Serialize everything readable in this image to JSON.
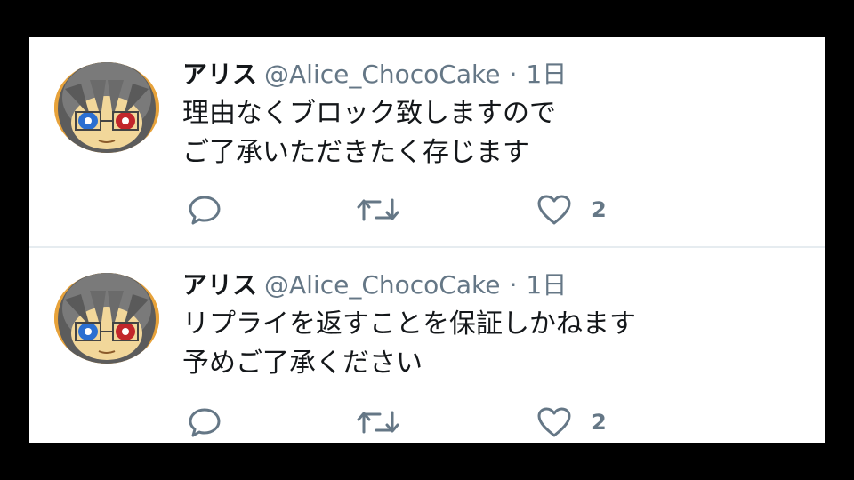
{
  "tweets": [
    {
      "display_name": "アリス",
      "handle": "@Alice_ChocoCake",
      "separator": "·",
      "time": "1日",
      "lines": [
        "理由なくブロック致しますので",
        "ご了承いただきたく存じます"
      ],
      "like_count": "2",
      "avatar_icon": "avatar-anime-girl",
      "reply_icon": "reply-icon",
      "retweet_icon": "retweet-icon",
      "like_icon": "heart-icon"
    },
    {
      "display_name": "アリス",
      "handle": "@Alice_ChocoCake",
      "separator": "·",
      "time": "1日",
      "lines": [
        "リプライを返すことを保証しかねます",
        "予めご了承ください"
      ],
      "like_count": "2",
      "avatar_icon": "avatar-anime-girl",
      "reply_icon": "reply-icon",
      "retweet_icon": "retweet-icon",
      "like_icon": "heart-icon"
    }
  ],
  "colors": {
    "background": "#000000",
    "panel": "#ffffff",
    "text": "#14171a",
    "muted": "#657786",
    "divider": "#e6ecf0"
  }
}
